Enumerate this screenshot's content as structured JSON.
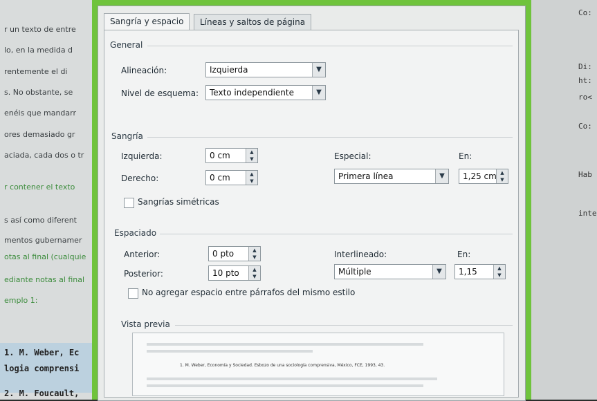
{
  "background_doc": {
    "left_lines": [
      {
        "text": "r un texto de entre",
        "green": false
      },
      {
        "text": "lo, en la medida d",
        "green": false
      },
      {
        "text": "rentemente el di",
        "green": false
      },
      {
        "text": "s. No obstante, se",
        "green": false
      },
      {
        "text": "enéis que mandarr",
        "green": false
      },
      {
        "text": "ores demasiado gr",
        "green": false
      },
      {
        "text": "aciada, cada dos o tr",
        "green": false
      },
      {
        "text": "r contener el texto",
        "green": true
      },
      {
        "text": "s así como diferent",
        "green": false
      },
      {
        "text": "mentos gubernamer",
        "green": false
      },
      {
        "text": "otas al final (cualquie",
        "green": true
      },
      {
        "text": "ediante notas al final",
        "green": true
      },
      {
        "text": "emplo 1:",
        "green": true
      }
    ],
    "left_mono": [
      "1. M. Weber, Ec",
      "logia comprensi",
      "2. M. Foucault,"
    ],
    "right_mono": [
      "Co:",
      "Di:",
      "ht:",
      "ro<",
      "Co:",
      "Hab",
      "inte"
    ]
  },
  "dialog": {
    "tabs": [
      {
        "label": "Sangría y espacio",
        "active": true
      },
      {
        "label": "Líneas y saltos de página",
        "active": false
      }
    ],
    "general": {
      "title": "General",
      "alineacion_label": "Alineación:",
      "alineacion_value": "Izquierda",
      "nivel_label": "Nivel de esquema:",
      "nivel_value": "Texto independiente"
    },
    "sangria": {
      "title": "Sangría",
      "izquierda_label": "Izquierda:",
      "izquierda_value": "0 cm",
      "derecho_label": "Derecho:",
      "derecho_value": "0 cm",
      "especial_label": "Especial:",
      "especial_value": "Primera línea",
      "en_label": "En:",
      "en_value": "1,25 cm",
      "simetricas_label": "Sangrías simétricas",
      "simetricas_checked": false
    },
    "espaciado": {
      "title": "Espaciado",
      "anterior_label": "Anterior:",
      "anterior_value": "0 pto",
      "posterior_label": "Posterior:",
      "posterior_value": "10 pto",
      "interlineado_label": "Interlineado:",
      "interlineado_value": "Múltiple",
      "en_label": "En:",
      "en_value": "1,15",
      "no_agregar_label": "No agregar espacio entre párrafos del mismo estilo",
      "no_agregar_checked": false
    },
    "vista_previa": {
      "title": "Vista previa",
      "sample_text": "1. M. Weber, Economía y Sociedad. Esbozo de una sociología comprensiva, México, FCE, 1993, 43."
    }
  },
  "colors": {
    "frame_green": "#6fc33c",
    "dialog_bg": "#e9ebea"
  }
}
